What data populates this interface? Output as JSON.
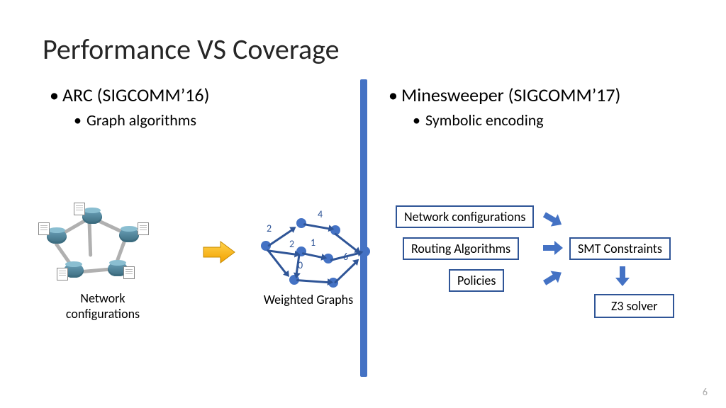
{
  "title": "Performance VS Coverage",
  "page_number": "6",
  "left": {
    "heading": "ARC (SIGCOMM’16)",
    "sub": "Graph algorithms",
    "caption_net": "Network configurations",
    "caption_graph": "Weighted Graphs",
    "weights": {
      "w0": "0",
      "w1": "1",
      "w2a": "2",
      "w2b": "2",
      "w4": "4",
      "w6": "6"
    }
  },
  "right": {
    "heading": "Minesweeper (SIGCOMM’17)",
    "sub": "Symbolic encoding",
    "boxes": {
      "netcfg": "Network configurations",
      "routing": "Routing Algorithms",
      "policies": "Policies",
      "smt": "SMT Constraints",
      "z3": "Z3 solver"
    }
  }
}
